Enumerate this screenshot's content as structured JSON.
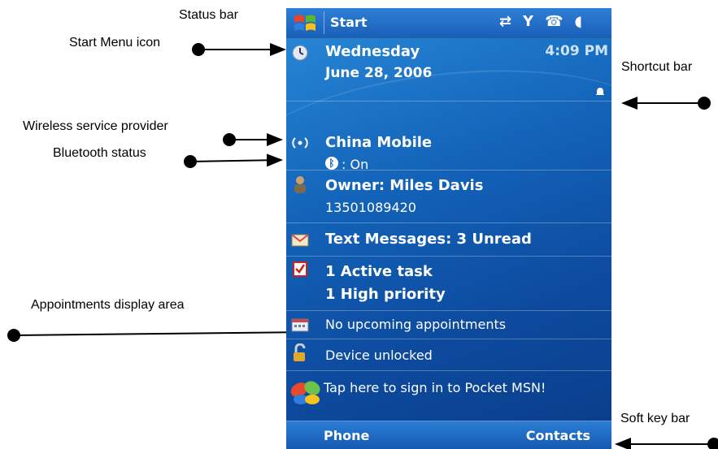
{
  "annotations": {
    "status_bar": "Status bar",
    "start_menu_icon": "Start Menu icon",
    "wireless_provider": "Wireless service provider",
    "bluetooth_status": "Bluetooth status",
    "appointments_area": "Appointments display area",
    "shortcut_bar": "Shortcut bar",
    "soft_key_bar": "Soft key bar"
  },
  "status_bar": {
    "start_label": "Start",
    "icons": [
      "sync-icon",
      "signal-antenna-icon",
      "phone-ring-icon",
      "speaker-icon"
    ]
  },
  "today": {
    "date": {
      "day": "Wednesday",
      "full_date": "June 28, 2006",
      "time": "4:09 PM"
    },
    "carrier": {
      "name": "China Mobile",
      "bluetooth": ": On"
    },
    "owner": {
      "name": "Owner: Miles Davis",
      "phone": "13501089420"
    },
    "messages": "Text Messages: 3 Unread",
    "tasks": {
      "active": "1 Active task",
      "priority": "1 High priority"
    },
    "appointments": "No upcoming appointments",
    "lock": "Device unlocked",
    "msn": "Tap here to sign in to Pocket MSN!"
  },
  "softkeys": {
    "left": "Phone",
    "right": "Contacts"
  },
  "colors": {
    "screen_blue": "#1262b8",
    "bar_blue": "#1a5fb8"
  }
}
